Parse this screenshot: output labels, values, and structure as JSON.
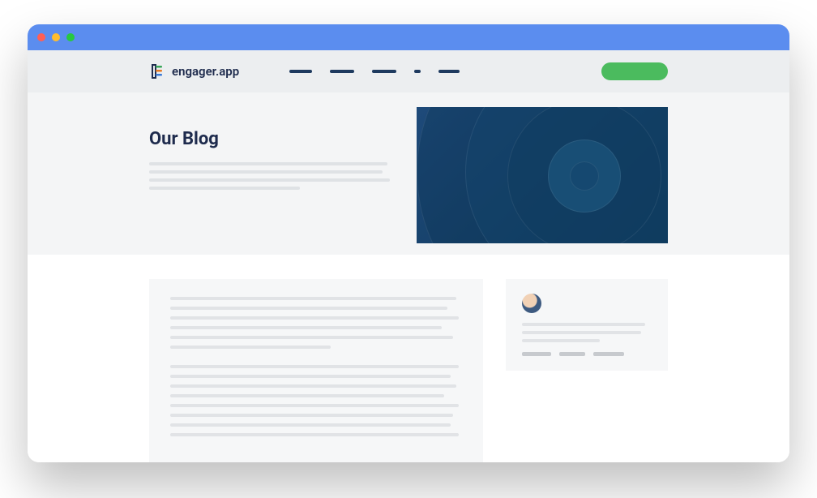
{
  "brand": {
    "name": "engager.app"
  },
  "hero": {
    "title": "Our Blog"
  },
  "colors": {
    "titlebar": "#5b8def",
    "cta": "#4bbb5e",
    "heading": "#1e2b4d"
  }
}
